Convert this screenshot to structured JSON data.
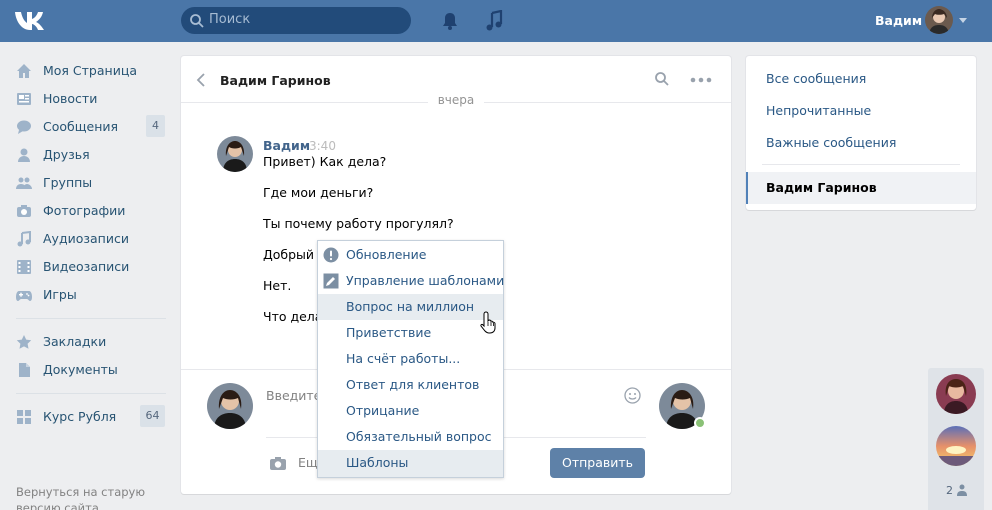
{
  "header": {
    "search_placeholder": "Поиск",
    "user_name": "Вадим",
    "brand_color": "#4a76a8"
  },
  "left_menu": {
    "items": [
      {
        "label": "Моя Страница",
        "icon": "home-icon"
      },
      {
        "label": "Новости",
        "icon": "news-icon"
      },
      {
        "label": "Сообщения",
        "icon": "messages-icon",
        "count": "4"
      },
      {
        "label": "Друзья",
        "icon": "friends-icon"
      },
      {
        "label": "Группы",
        "icon": "groups-icon"
      },
      {
        "label": "Фотографии",
        "icon": "camera-icon"
      },
      {
        "label": "Аудиозаписи",
        "icon": "music-icon"
      },
      {
        "label": "Видеозаписи",
        "icon": "video-icon"
      },
      {
        "label": "Игры",
        "icon": "gamepad-icon"
      }
    ],
    "extra": [
      {
        "label": "Закладки",
        "icon": "star-icon"
      },
      {
        "label": "Документы",
        "icon": "document-icon"
      }
    ],
    "apps": [
      {
        "label": "Курс Рубля",
        "icon": "apps-icon",
        "count": "64"
      }
    ],
    "old_version": "Вернуться на старую версию сайта"
  },
  "chat": {
    "title": "Вадим Гаринов",
    "day_label": "вчера",
    "author": "Вадим",
    "time": "3:40",
    "messages": [
      "Привет) Как дела?",
      "Где мои деньги?",
      "Ты почему работу прогулял?",
      "Добрый д",
      "Нет.",
      "Что дела"
    ],
    "input_placeholder": "Введите",
    "more_label": "Ещ",
    "send_label": "Отправить"
  },
  "templates_menu": {
    "items": [
      {
        "label": "Обновление",
        "icon": "info-icon"
      },
      {
        "label": "Управление шаблонами",
        "icon": "edit-icon"
      },
      {
        "label": "Вопрос на миллион"
      },
      {
        "label": "Приветствие"
      },
      {
        "label": "На счёт работы..."
      },
      {
        "label": "Ответ для клиентов"
      },
      {
        "label": "Отрицание"
      },
      {
        "label": "Обязательный вопрос"
      },
      {
        "label": "Шаблоны"
      }
    ],
    "hovered": "Вопрос на миллион"
  },
  "right_panel": {
    "items": [
      "Все сообщения",
      "Непрочитанные",
      "Важные сообщения"
    ],
    "active": "Вадим Гаринов"
  },
  "friends_float": {
    "count": "2"
  }
}
